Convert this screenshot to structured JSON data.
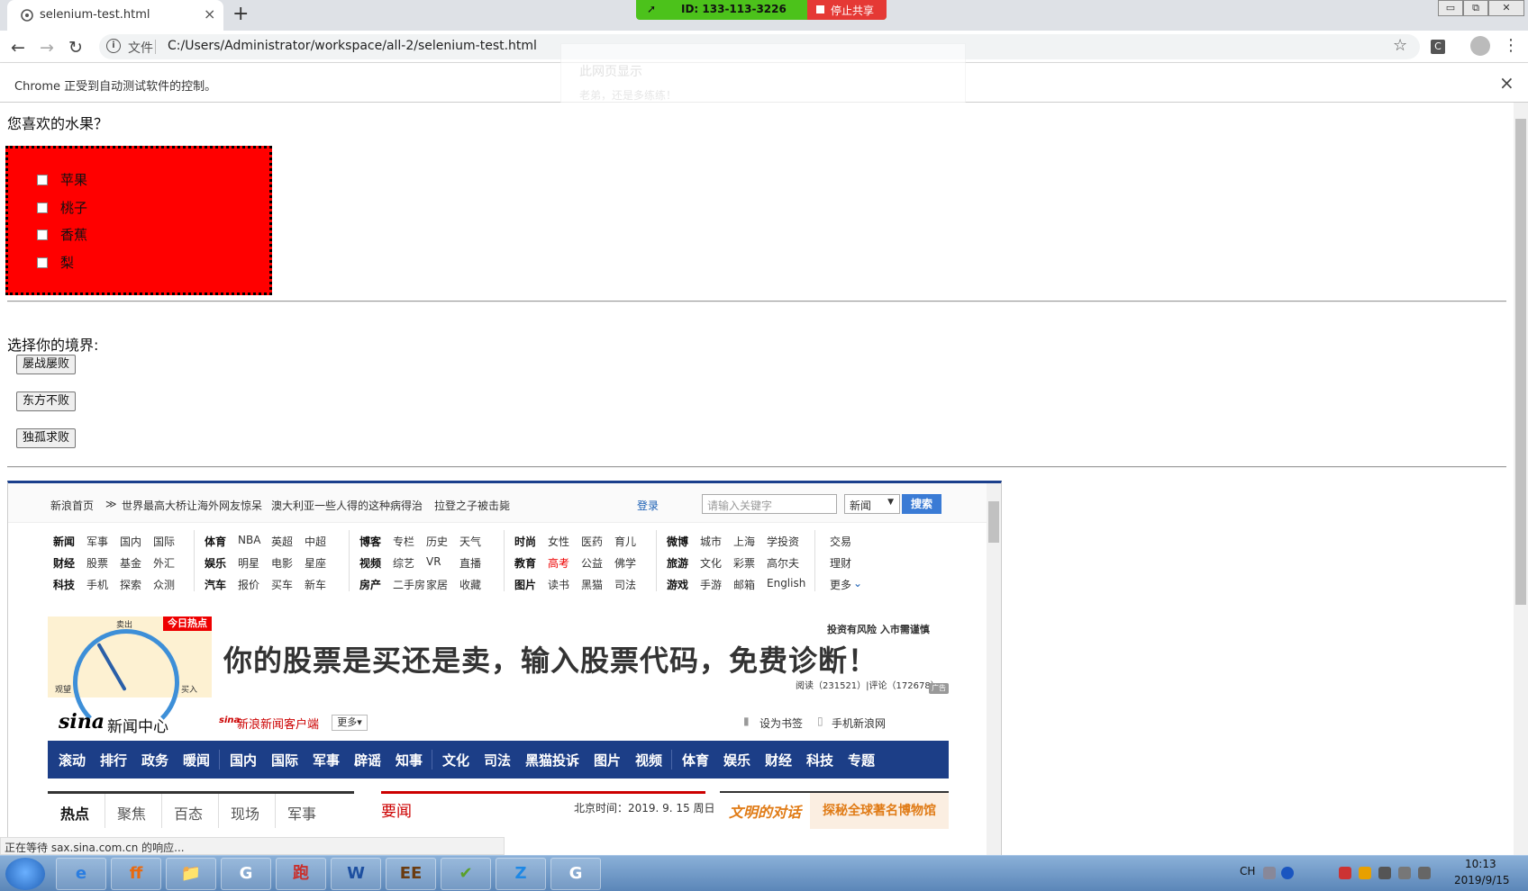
{
  "browser": {
    "tab_title": "selenium-test.html",
    "tab_close": "×",
    "new_tab": "+",
    "share_id": "ID: 133-113-3226",
    "share_stop": "停止共享",
    "file_label": "文件",
    "url": "C:/Users/Administrator/workspace/all-2/selenium-test.html",
    "ext_label": "C",
    "infobar_text": "Chrome 正受到自动测试软件的控制。",
    "infobar_close": "×",
    "status_text": "正在等待 sax.sina.com.cn 的响应...",
    "ghost_title": "此网页显示",
    "ghost_message": "老弟，还是多练练！"
  },
  "page": {
    "question": "您喜欢的水果？",
    "fruits": [
      "苹果",
      "桃子",
      "香蕉",
      "梨"
    ],
    "state_title": "选择你的境界:",
    "state_buttons": [
      "屡战屡败",
      "东方不败",
      "独孤求败"
    ],
    "fruit_box_color": "#ff0000"
  },
  "sina": {
    "home": "新浪首页",
    "headlines": [
      "世界最高大桥让海外网友惊呆",
      "澳大利亚一些人得的这种病得治",
      "拉登之子被击毙"
    ],
    "login": "登录",
    "search_placeholder": "请输入关键字",
    "search_select": "新闻",
    "search_btn": "搜索",
    "nav_groups": [
      [
        [
          "新闻",
          "军事",
          "国内",
          "国际"
        ],
        [
          "财经",
          "股票",
          "基金",
          "外汇"
        ],
        [
          "科技",
          "手机",
          "探索",
          "众测"
        ]
      ],
      [
        [
          "体育",
          "NBA",
          "英超",
          "中超"
        ],
        [
          "娱乐",
          "明星",
          "电影",
          "星座"
        ],
        [
          "汽车",
          "报价",
          "买车",
          "新车"
        ]
      ],
      [
        [
          "博客",
          "专栏",
          "历史",
          "天气"
        ],
        [
          "视频",
          "综艺",
          "VR",
          "直播"
        ],
        [
          "房产",
          "二手房",
          "家居",
          "收藏"
        ]
      ],
      [
        [
          "时尚",
          "女性",
          "医药",
          "育儿"
        ],
        [
          "教育",
          "高考",
          "公益",
          "佛学"
        ],
        [
          "图片",
          "读书",
          "黑猫",
          "司法"
        ]
      ],
      [
        [
          "微博",
          "城市",
          "上海",
          "学投资"
        ],
        [
          "旅游",
          "文化",
          "彩票",
          "高尔夫"
        ],
        [
          "游戏",
          "手游",
          "邮箱",
          "English"
        ]
      ]
    ],
    "nav_extra": [
      "交易",
      "理财",
      "更多"
    ],
    "ad_hot": "今日热点",
    "ad_sell": "卖出",
    "ad_watch": "观望",
    "ad_buy": "买入",
    "ad_headline": "你的股票是买还是卖，输入股票代码，免费诊断！",
    "ad_risk": "投资有风险 入市需谨慎",
    "ad_stats": "阅读（231521）|评论（172678）",
    "ad_tag": "广告",
    "logo": "sina",
    "logo_sub": "新闻中心",
    "client_link": "新浪新闻客户端",
    "more": "更多",
    "bookmark": "设为书签",
    "mobile": "手机新浪网",
    "blue_nav": [
      "滚动",
      "排行",
      "政务",
      "暖闻",
      "国内",
      "国际",
      "军事",
      "辟谣",
      "知事",
      "文化",
      "司法",
      "黑猫投诉",
      "图片",
      "视频",
      "体育",
      "娱乐",
      "财经",
      "科技",
      "专题"
    ],
    "tabs": [
      "热点",
      "聚焦",
      "百态",
      "现场",
      "军事"
    ],
    "news_title": "要闻",
    "news_time": "北京时间：2019. 9. 15  周日",
    "wen_left": "文明的对话",
    "wen_right": "探秘全球著名博物馆"
  },
  "taskbar": {
    "apps": [
      "e",
      "ff",
      "📁",
      "G",
      "跑",
      "W",
      "EE",
      "✔",
      "Z",
      "G"
    ],
    "lang": "CH",
    "time": "10:13",
    "date": "2019/9/15"
  }
}
